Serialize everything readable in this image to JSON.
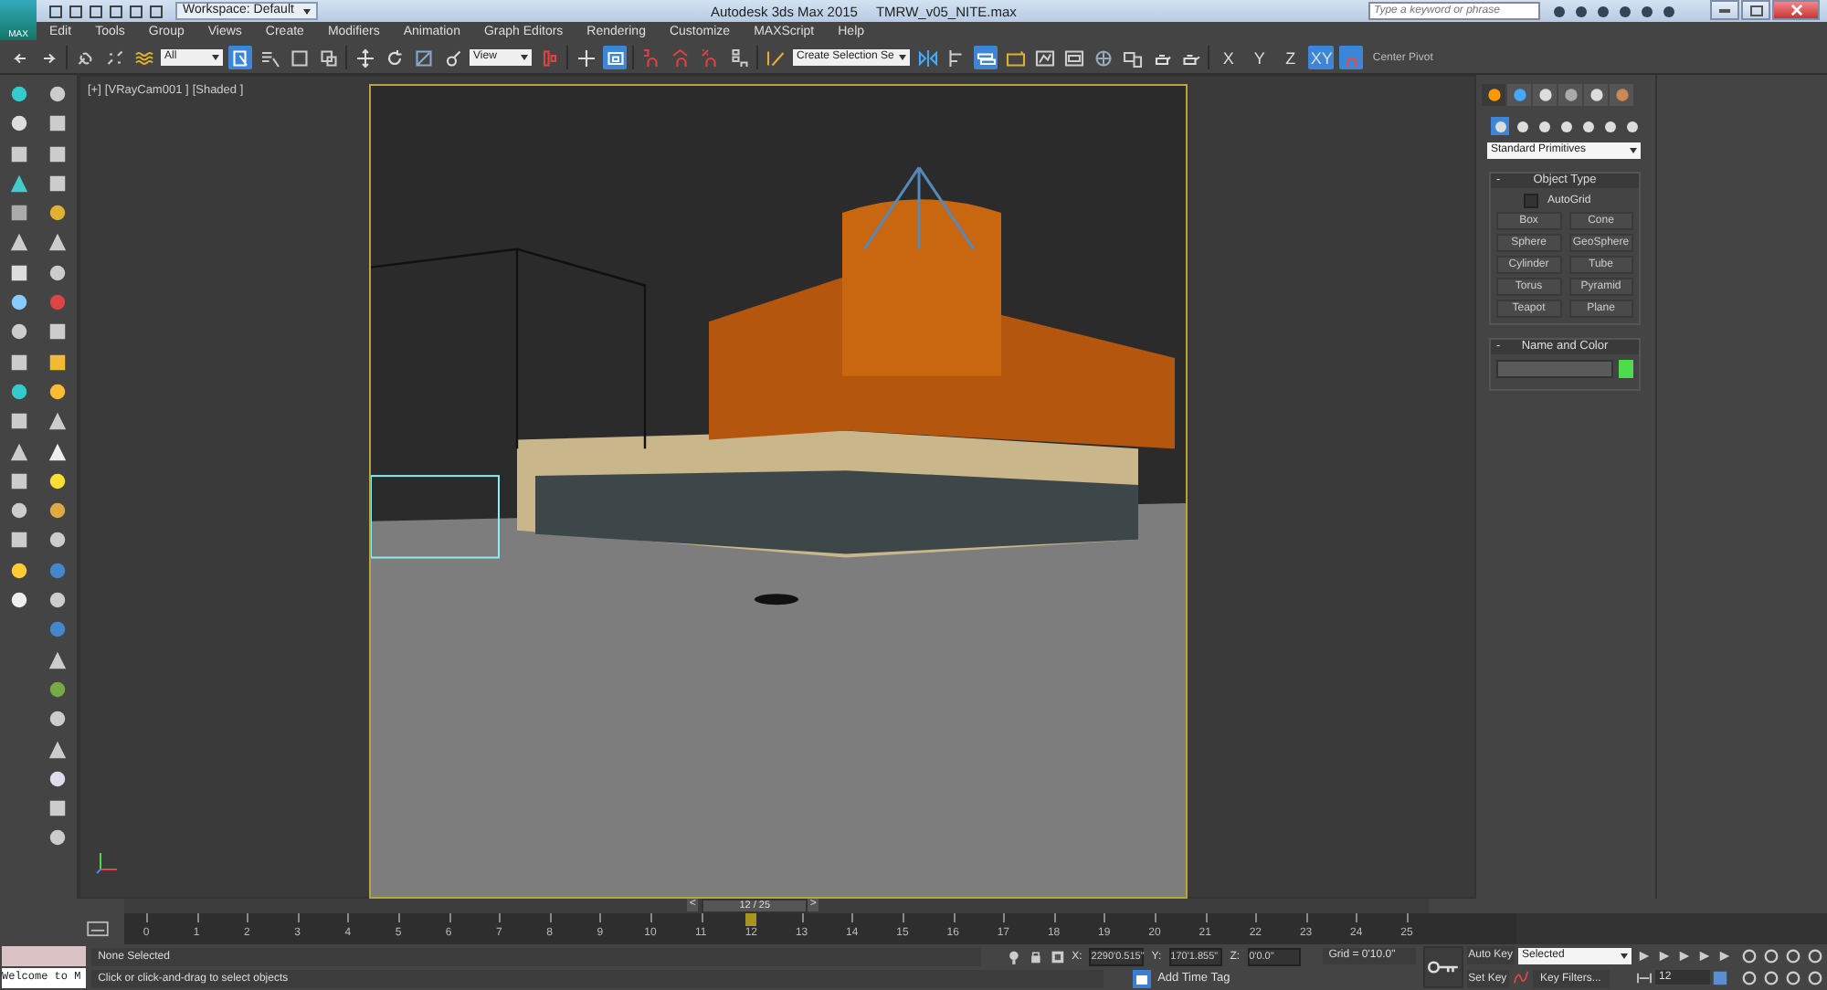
{
  "title_bar": {
    "app_logo": "MAX",
    "workspace": "Workspace: Default",
    "app_title": "Autodesk 3ds Max 2015",
    "file_name": "TMRW_v05_NITE.max",
    "search": {
      "placeholder": "Type a keyword or phrase"
    }
  },
  "menu_bar": [
    "Edit",
    "Tools",
    "Group",
    "Views",
    "Create",
    "Modifiers",
    "Animation",
    "Graph Editors",
    "Rendering",
    "Customize",
    "MAXScript",
    "Help"
  ],
  "main_toolbar": [
    {
      "kind": "icon",
      "selected": false
    },
    {
      "kind": "icon",
      "selected": false
    },
    {
      "kind": "sep"
    },
    {
      "kind": "icon",
      "selected": false
    },
    {
      "kind": "icon",
      "selected": false
    },
    {
      "kind": "icon",
      "selected": false
    },
    {
      "kind": "dropdown",
      "value": "All"
    },
    {
      "kind": "icon",
      "selected": true
    },
    {
      "kind": "icon",
      "selected": false
    },
    {
      "kind": "icon",
      "selected": false
    },
    {
      "kind": "icon",
      "selected": false
    },
    {
      "kind": "sep"
    },
    {
      "kind": "icon",
      "selected": false
    },
    {
      "kind": "icon",
      "selected": false
    },
    {
      "kind": "icon",
      "selected": false
    },
    {
      "kind": "icon",
      "selected": false
    },
    {
      "kind": "dropdown",
      "value": "View"
    },
    {
      "kind": "icon",
      "selected": false
    },
    {
      "kind": "sep"
    },
    {
      "kind": "icon",
      "selected": false
    },
    {
      "kind": "icon",
      "selected": true
    },
    {
      "kind": "sep"
    },
    {
      "kind": "icon",
      "selected": false
    },
    {
      "kind": "icon",
      "selected": false
    },
    {
      "kind": "icon",
      "selected": false
    },
    {
      "kind": "icon",
      "selected": false
    },
    {
      "kind": "sep"
    },
    {
      "kind": "icon",
      "selected": false
    },
    {
      "kind": "dropdown",
      "value": "Create Selection Se"
    },
    {
      "kind": "icon",
      "selected": false
    },
    {
      "kind": "icon",
      "selected": false
    },
    {
      "kind": "icon",
      "selected": true
    },
    {
      "kind": "icon",
      "selected": false
    },
    {
      "kind": "icon",
      "selected": false
    },
    {
      "kind": "icon",
      "selected": false
    },
    {
      "kind": "icon",
      "selected": false
    },
    {
      "kind": "icon",
      "selected": false
    },
    {
      "kind": "icon",
      "selected": false
    },
    {
      "kind": "icon",
      "selected": false
    },
    {
      "kind": "sep"
    },
    {
      "kind": "text",
      "label": "X",
      "selected": false
    },
    {
      "kind": "text",
      "label": "Y",
      "selected": false
    },
    {
      "kind": "text",
      "label": "Z",
      "selected": false
    },
    {
      "kind": "text",
      "label": "XY",
      "selected": true
    },
    {
      "kind": "icon",
      "selected": true
    },
    {
      "kind": "label",
      "text": "Center Pivot"
    }
  ],
  "viewport": {
    "labels": [
      "[+]",
      "[VRayCam001 ]",
      "[Shaded ]"
    ],
    "active": true
  },
  "command_panel": {
    "tabs": [
      {
        "selected": true
      },
      {
        "selected": false
      },
      {
        "selected": false
      },
      {
        "selected": false
      },
      {
        "selected": false
      },
      {
        "selected": false
      }
    ],
    "categories": [
      {
        "selected": true
      },
      {
        "selected": false
      },
      {
        "selected": false
      },
      {
        "selected": false
      },
      {
        "selected": false
      },
      {
        "selected": false
      },
      {
        "selected": false
      }
    ],
    "object_class": "Standard Primitives",
    "object_type": {
      "toggle": "-",
      "title": "Object Type",
      "autogrid": {
        "label": "AutoGrid",
        "checked": false
      },
      "buttons": [
        "Box",
        "Cone",
        "Sphere",
        "GeoSphere",
        "Cylinder",
        "Tube",
        "Torus",
        "Pyramid",
        "Teapot",
        "Plane"
      ]
    },
    "name_and_color": {
      "toggle": "-",
      "title": "Name and Color",
      "color": "#4cdc4c"
    }
  },
  "time_slider": {
    "prev": "<",
    "frame": "12 / 25",
    "next": ">",
    "level": 0.48
  },
  "track_bar": {
    "ticks": [
      "0",
      "1",
      "2",
      "3",
      "4",
      "5",
      "6",
      "7",
      "8",
      "9",
      "10",
      "11",
      "12",
      "13",
      "14",
      "15",
      "16",
      "17",
      "18",
      "19",
      "20",
      "21",
      "22",
      "23",
      "24",
      "25"
    ]
  },
  "status_bar": {
    "listener_output": "Welcome to M",
    "selection": "None Selected",
    "prompt": "Click or click-and-drag to select objects",
    "coords": [
      {
        "label": "X:",
        "value": "2290'0.515\""
      },
      {
        "label": "Y:",
        "value": "170'1.855\""
      },
      {
        "label": "Z:",
        "value": "0'0.0\""
      }
    ],
    "grid": "Grid = 0'10.0\"",
    "add_time_tag": "Add Time Tag",
    "auto_key": "Auto Key",
    "set_key": "Set Key",
    "key_mode": "Selected",
    "key_filters": "Key Filters...",
    "current_frame": "12"
  }
}
